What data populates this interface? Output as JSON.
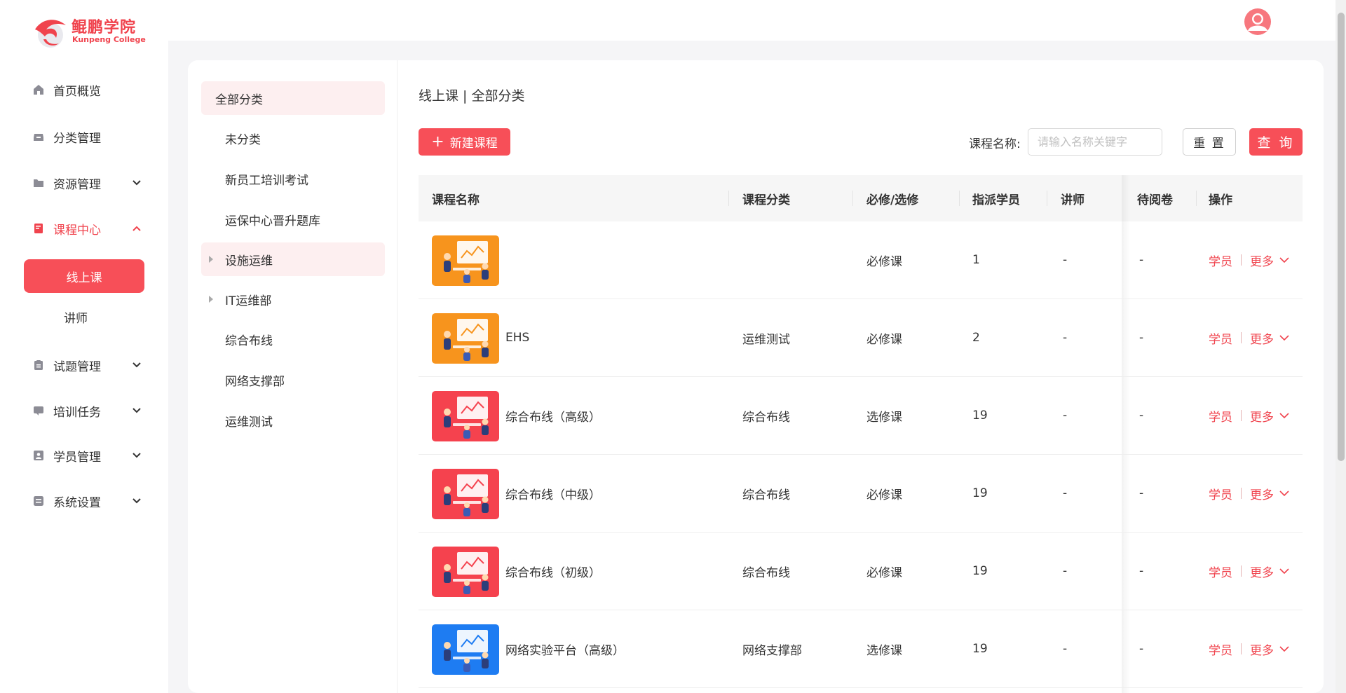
{
  "brand": {
    "name_cn": "鲲鹏学院",
    "name_en": "Kunpeng College",
    "accent": "#f74f58"
  },
  "sidebar": {
    "items": [
      {
        "label": "首页概览",
        "icon": "home-icon"
      },
      {
        "label": "分类管理",
        "icon": "inbox-icon"
      },
      {
        "label": "资源管理",
        "icon": "folder-icon",
        "expandable": true
      },
      {
        "label": "课程中心",
        "icon": "book-icon",
        "expandable": true,
        "expanded": true,
        "active": true
      },
      {
        "label": "试题管理",
        "icon": "clipboard-icon",
        "expandable": true
      },
      {
        "label": "培训任务",
        "icon": "chat-icon",
        "expandable": true
      },
      {
        "label": "学员管理",
        "icon": "user-card-icon",
        "expandable": true
      },
      {
        "label": "系统设置",
        "icon": "settings-box-icon",
        "expandable": true
      }
    ],
    "sub_items": [
      {
        "label": "线上课",
        "active": true
      },
      {
        "label": "讲师",
        "active": false
      }
    ]
  },
  "categories": [
    {
      "label": "全部分类",
      "selected": true
    },
    {
      "label": "未分类"
    },
    {
      "label": "新员工培训考试"
    },
    {
      "label": "运保中心晋升题库"
    },
    {
      "label": "设施运维",
      "has_children": true,
      "hover": true
    },
    {
      "label": "IT运维部",
      "has_children": true
    },
    {
      "label": "综合布线"
    },
    {
      "label": "网络支撑部"
    },
    {
      "label": "运维测试"
    }
  ],
  "content": {
    "breadcrumb": "线上课 | 全部分类",
    "new_button": "新建课程",
    "search_label": "课程名称:",
    "search_placeholder": "请输入名称关键字",
    "search_value": "",
    "reset_button": "重 置",
    "query_button": "查 询"
  },
  "table": {
    "headers": [
      "课程名称",
      "课程分类",
      "必修/选修",
      "指派学员",
      "讲师",
      "待阅卷",
      "操作"
    ],
    "rows": [
      {
        "thumb": "orange",
        "name": "",
        "category": "",
        "type": "必修课",
        "assigned": "1",
        "lecturer": "-",
        "pending": "-",
        "op_students": "学员",
        "op_more": "更多"
      },
      {
        "thumb": "orange",
        "name": "EHS",
        "category": "运维测试",
        "type": "必修课",
        "assigned": "2",
        "lecturer": "-",
        "pending": "-",
        "op_students": "学员",
        "op_more": "更多"
      },
      {
        "thumb": "red",
        "name": "综合布线（高级）",
        "category": "综合布线",
        "type": "选修课",
        "assigned": "19",
        "lecturer": "-",
        "pending": "-",
        "op_students": "学员",
        "op_more": "更多"
      },
      {
        "thumb": "red",
        "name": "综合布线（中级）",
        "category": "综合布线",
        "type": "必修课",
        "assigned": "19",
        "lecturer": "-",
        "pending": "-",
        "op_students": "学员",
        "op_more": "更多"
      },
      {
        "thumb": "red",
        "name": "综合布线（初级）",
        "category": "综合布线",
        "type": "必修课",
        "assigned": "19",
        "lecturer": "-",
        "pending": "-",
        "op_students": "学员",
        "op_more": "更多"
      },
      {
        "thumb": "blue",
        "name": "网络实验平台（高级）",
        "category": "网络支撑部",
        "type": "选修课",
        "assigned": "19",
        "lecturer": "-",
        "pending": "-",
        "op_students": "学员",
        "op_more": "更多"
      }
    ]
  },
  "colors": {
    "accent": "#f74f58",
    "accent_light": "#fdeff0",
    "thumb_orange": "#f7941d",
    "thumb_red": "#f5424e",
    "thumb_blue": "#1e7cf2"
  }
}
